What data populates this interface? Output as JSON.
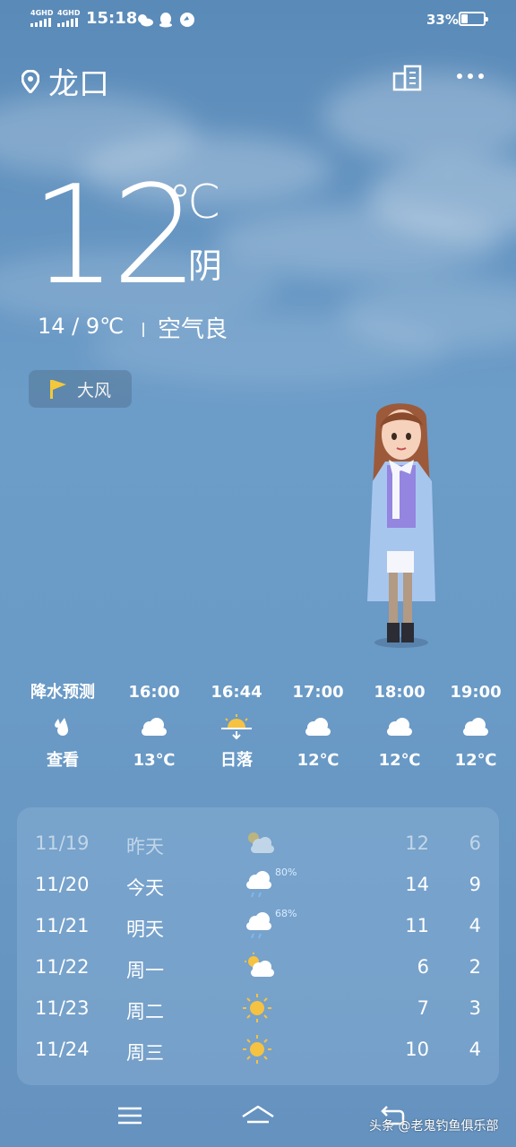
{
  "status_bar": {
    "network_1": "4GHD",
    "network_2": "4GHD",
    "time": "15:18",
    "battery": "33%"
  },
  "header": {
    "city": "龙口",
    "icons": [
      "location-pin-icon",
      "city-list-icon",
      "more-icon"
    ]
  },
  "current": {
    "temperature": "12",
    "unit": "℃",
    "condition": "阴",
    "range": "14 / 9℃",
    "air_quality": "空气良"
  },
  "alert": {
    "label": "大风",
    "icon": "flag-icon",
    "icon_color": "#f3c83a"
  },
  "hourly": [
    {
      "time": "降水预测",
      "icon": "raindrop-icon",
      "value": "查看"
    },
    {
      "time": "16:00",
      "icon": "cloud-icon",
      "value": "13℃"
    },
    {
      "time": "16:44",
      "icon": "sunset-icon",
      "value": "日落"
    },
    {
      "time": "17:00",
      "icon": "cloud-icon",
      "value": "12℃"
    },
    {
      "time": "18:00",
      "icon": "cloud-icon",
      "value": "12℃"
    },
    {
      "time": "19:00",
      "icon": "cloud-icon",
      "value": "12℃"
    }
  ],
  "daily": [
    {
      "date": "11/19",
      "day": "昨天",
      "icon": "partly-cloudy-icon",
      "precip": "",
      "high": "12",
      "low": "6"
    },
    {
      "date": "11/20",
      "day": "今天",
      "icon": "rain-icon",
      "precip": "80%",
      "high": "14",
      "low": "9"
    },
    {
      "date": "11/21",
      "day": "明天",
      "icon": "rain-icon",
      "precip": "68%",
      "high": "11",
      "low": "4"
    },
    {
      "date": "11/22",
      "day": "周一",
      "icon": "partly-cloudy-icon",
      "precip": "",
      "high": "6",
      "low": "2"
    },
    {
      "date": "11/23",
      "day": "周二",
      "icon": "sun-icon",
      "precip": "",
      "high": "7",
      "low": "3"
    },
    {
      "date": "11/24",
      "day": "周三",
      "icon": "sun-icon",
      "precip": "",
      "high": "10",
      "low": "4"
    }
  ],
  "watermark": "头条 @老鬼钓鱼俱乐部",
  "colors": {
    "sky_top": "#5a8ab8",
    "sky_bottom": "#6592bf",
    "sun": "#f5c242",
    "precip_text": "#d8ecff"
  }
}
